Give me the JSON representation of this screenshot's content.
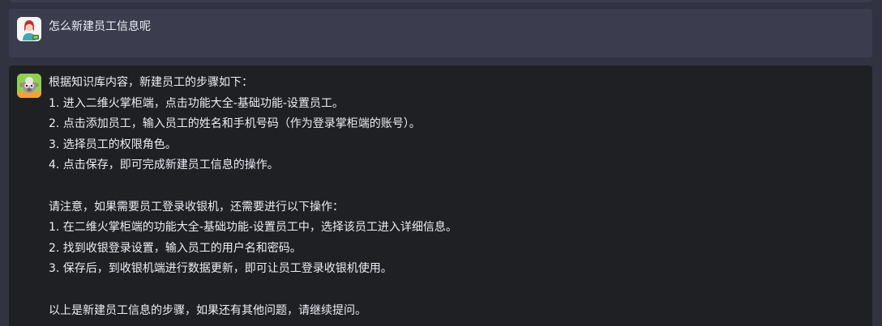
{
  "conversation": {
    "user_message": {
      "avatar_icon": "user-avatar-icon",
      "text": "怎么新建员工信息呢"
    },
    "bot_message": {
      "avatar_icon": "bot-avatar-icon",
      "lines": [
        "根据知识库内容，新建员工的步骤如下：",
        "1. 进入二维火掌柜端，点击功能大全-基础功能-设置员工。",
        "2. 点击添加员工，输入员工的姓名和手机号码（作为登录掌柜端的账号）。",
        "3. 选择员工的权限角色。",
        "4. 点击保存，即可完成新建员工信息的操作。",
        "",
        "请注意，如果需要员工登录收银机，还需要进行以下操作：",
        "1. 在二维火掌柜端的功能大全-基础功能-设置员工中，选择该员工进入详细信息。",
        "2. 找到收银登录设置，输入员工的用户名和密码。",
        "3. 保存后，到收银机端进行数据更新，即可让员工登录收银机使用。",
        "",
        "以上是新建员工信息的步骤，如果还有其他问题，请继续提问。"
      ]
    }
  },
  "colors": {
    "page_background": "#323341",
    "user_bubble": "#3b3c4d",
    "bot_bubble": "#1f2023",
    "text": "#eceef3",
    "bot_avatar_bg": "#8fd14f"
  }
}
